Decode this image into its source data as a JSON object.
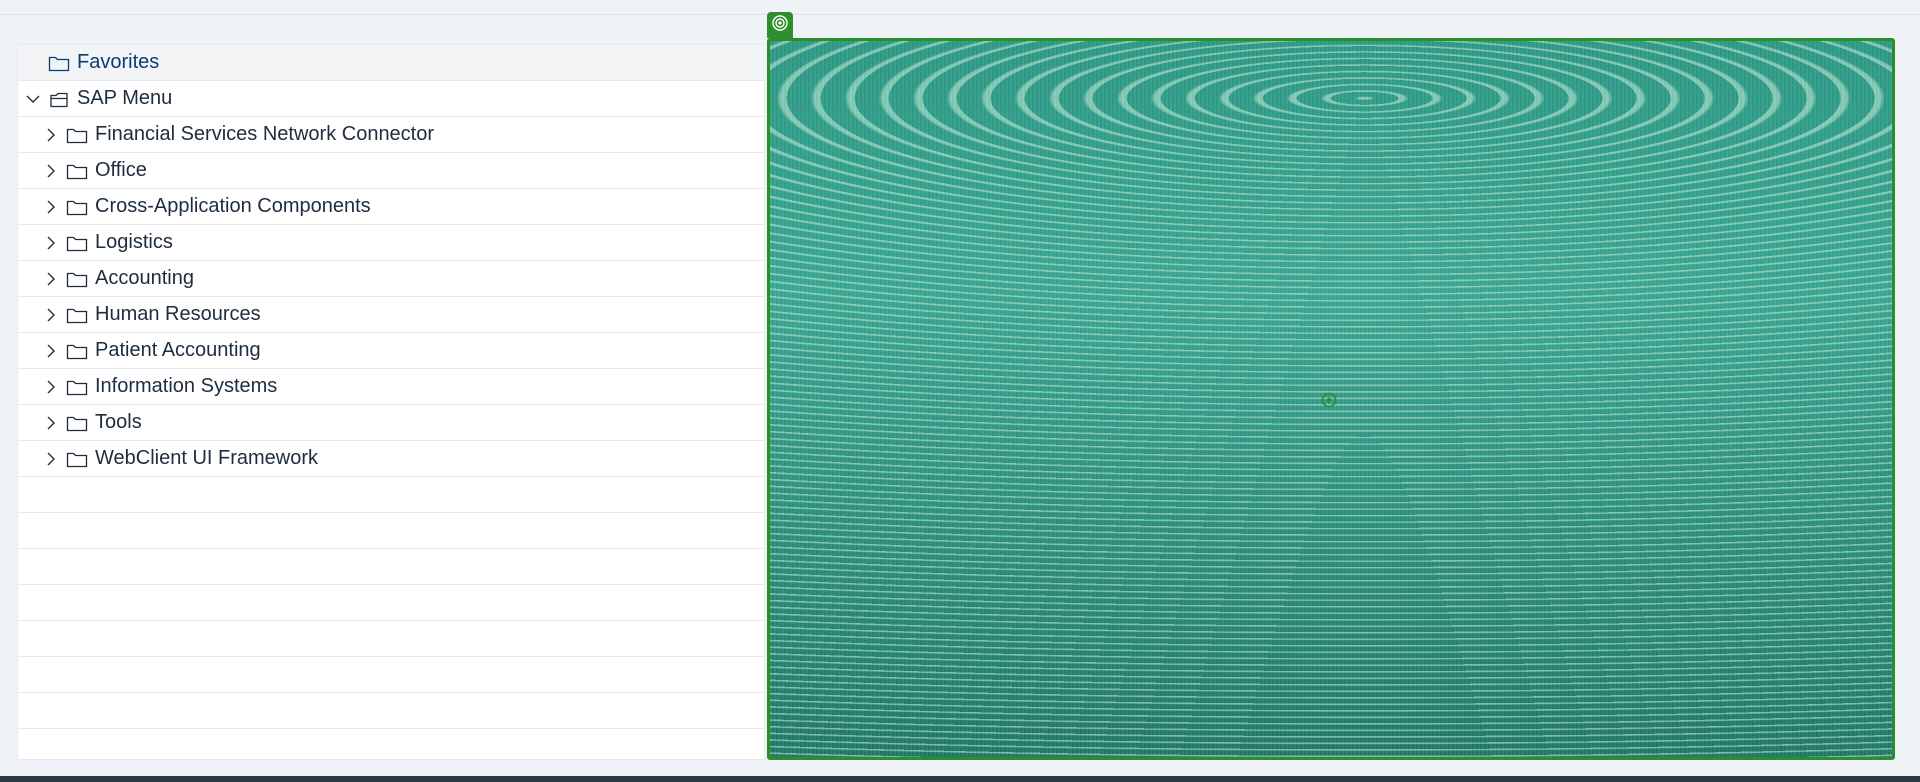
{
  "favorites": {
    "label": "Favorites"
  },
  "sap_menu": {
    "label": "SAP Menu",
    "items": [
      {
        "label": "Financial Services Network Connector"
      },
      {
        "label": "Office"
      },
      {
        "label": "Cross-Application Components"
      },
      {
        "label": "Logistics"
      },
      {
        "label": "Accounting"
      },
      {
        "label": "Human Resources"
      },
      {
        "label": "Patient Accounting"
      },
      {
        "label": "Information Systems"
      },
      {
        "label": "Tools"
      },
      {
        "label": "WebClient UI Framework"
      }
    ]
  },
  "colors": {
    "accent_green": "#2a8f2a",
    "favorites_text": "#0a3c78",
    "text": "#1d2d3e"
  },
  "icons": {
    "tree_expand": "chevron-right-icon",
    "tree_collapse": "chevron-down-icon",
    "folder": "folder-icon",
    "open_folder": "folder-open-icon",
    "frame_handle": "target-icon",
    "image_center": "target-icon"
  }
}
